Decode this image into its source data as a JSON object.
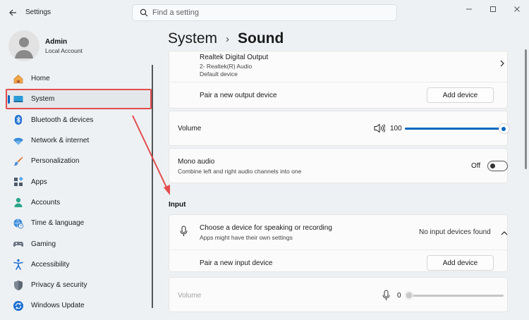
{
  "window": {
    "app_title": "Settings",
    "search_placeholder": "Find a setting"
  },
  "user": {
    "name": "Admin",
    "account_type": "Local Account"
  },
  "sidebar": {
    "items": [
      {
        "label": "Home",
        "icon": "home-icon"
      },
      {
        "label": "System",
        "icon": "system-icon",
        "active": true
      },
      {
        "label": "Bluetooth & devices",
        "icon": "bluetooth-icon"
      },
      {
        "label": "Network & internet",
        "icon": "wifi-icon"
      },
      {
        "label": "Personalization",
        "icon": "brush-icon"
      },
      {
        "label": "Apps",
        "icon": "apps-icon"
      },
      {
        "label": "Accounts",
        "icon": "person-icon"
      },
      {
        "label": "Time & language",
        "icon": "globe-clock-icon"
      },
      {
        "label": "Gaming",
        "icon": "gamepad-icon"
      },
      {
        "label": "Accessibility",
        "icon": "accessibility-icon"
      },
      {
        "label": "Privacy & security",
        "icon": "shield-icon"
      },
      {
        "label": "Windows Update",
        "icon": "update-icon"
      }
    ]
  },
  "breadcrumb": {
    "parent": "System",
    "separator": "›",
    "current": "Sound"
  },
  "output": {
    "device_name": "Realtek Digital Output",
    "device_detail": "2- Realtek(R) Audio",
    "device_status": "Default device",
    "pair_label": "Pair a new output device",
    "add_button": "Add device",
    "volume_label": "Volume",
    "volume_value": "100",
    "volume_level": 1.0,
    "mono_title": "Mono audio",
    "mono_sub": "Combine left and right audio channels into one",
    "mono_state": "Off"
  },
  "input": {
    "section_title": "Input",
    "choose_title": "Choose a device for speaking or recording",
    "choose_sub": "Apps might have their own settings",
    "no_devices": "No input devices found",
    "pair_label": "Pair a new input device",
    "add_button": "Add device",
    "volume_label": "Volume",
    "volume_value": "0",
    "volume_level": 0.0
  },
  "colors": {
    "accent": "#0067c0",
    "annotation_red": "#e34d4d"
  }
}
